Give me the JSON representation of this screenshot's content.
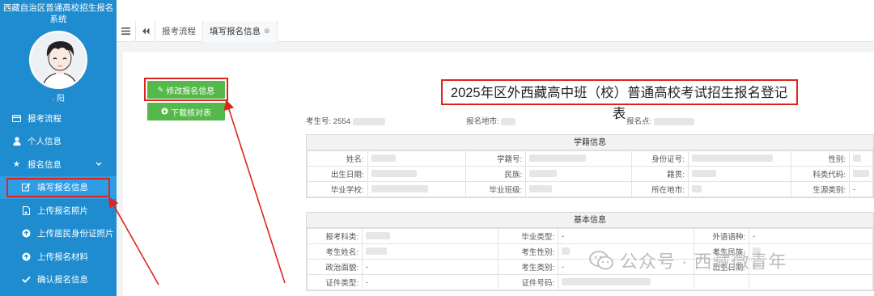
{
  "sidebar": {
    "system_title": "西藏自治区普通高校招生报名系统",
    "username": "· 阳",
    "items": [
      {
        "label": "报考流程",
        "icon": "card-icon"
      },
      {
        "label": "个人信息",
        "icon": "user-icon"
      },
      {
        "label": "报名信息",
        "icon": "star-icon"
      },
      {
        "label": "填写报名信息",
        "icon": "edit-icon"
      },
      {
        "label": "上传报名照片",
        "icon": "image-file-icon"
      },
      {
        "label": "上传居民身份证照片",
        "icon": "upload-icon"
      },
      {
        "label": "上传报名材料",
        "icon": "upload-icon"
      },
      {
        "label": "确认报名信息",
        "icon": "check-icon"
      }
    ]
  },
  "tabs": [
    {
      "label": "报考流程"
    },
    {
      "label": "填写报名信息"
    }
  ],
  "buttons": {
    "edit": "修改报名信息",
    "download": "下载核对表"
  },
  "page_title": "2025年区外西藏高中班（校）普通高校考试招生报名登记表",
  "meta": {
    "exam_no_label": "考生号:",
    "exam_no_value": "2554",
    "region_label": "报名地市:",
    "point_label": "报名点:"
  },
  "student_section": {
    "title": "学籍信息",
    "rows": [
      [
        "姓名:",
        "",
        "学籍号:",
        "",
        "身份证号:",
        "",
        "性别:",
        ""
      ],
      [
        "出生日期:",
        "",
        "民族:",
        "",
        "籍贯:",
        "",
        "科类代码:",
        ""
      ],
      [
        "毕业学校:",
        "",
        "毕业班级:",
        "",
        "所在地市:",
        "",
        "生源类别:",
        "-"
      ]
    ]
  },
  "basic_section": {
    "title": "基本信息",
    "rows": [
      [
        "报考科类:",
        "",
        "毕业类型:",
        "-",
        "外语语种:",
        "-"
      ],
      [
        "考生姓名:",
        "",
        "考生性别:",
        "",
        "考生民族:",
        ""
      ],
      [
        "政治面貌:",
        "-",
        "考生类别:",
        "-",
        "出生日期:",
        ""
      ],
      [
        "证件类型:",
        "-",
        "证件号码:",
        "",
        "",
        ""
      ]
    ]
  },
  "watermark": "公众号 · 西藏微青年",
  "colors": {
    "sidebar": "#1f8ccf",
    "button_green": "#55b84a",
    "highlight_red": "#e0241b"
  }
}
